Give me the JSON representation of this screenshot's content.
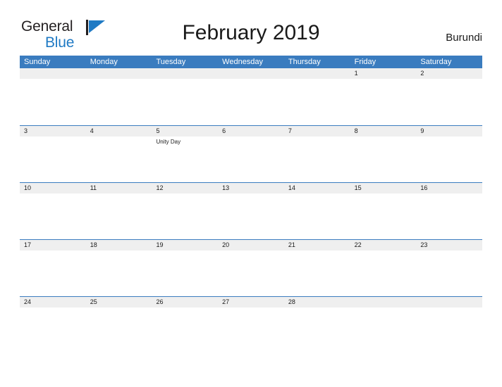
{
  "brand": {
    "name_top": "General",
    "name_bottom": "Blue",
    "flag_icon": "blue-flag-triangle",
    "color_top": "#231f20",
    "color_bottom": "#1f7ac4"
  },
  "header": {
    "title": "February 2019",
    "country": "Burundi"
  },
  "theme": {
    "header_blue": "#3a7cbf",
    "band_gray": "#efefef",
    "text_dark": "#1a1a1a",
    "page_background": "#ffffff"
  },
  "calendar": {
    "month": "February",
    "year": "2019",
    "weekday_headers": [
      "Sunday",
      "Monday",
      "Tuesday",
      "Wednesday",
      "Thursday",
      "Friday",
      "Saturday"
    ],
    "weeks": [
      [
        {
          "date": "",
          "events": []
        },
        {
          "date": "",
          "events": []
        },
        {
          "date": "",
          "events": []
        },
        {
          "date": "",
          "events": []
        },
        {
          "date": "",
          "events": []
        },
        {
          "date": "1",
          "events": []
        },
        {
          "date": "2",
          "events": []
        }
      ],
      [
        {
          "date": "3",
          "events": []
        },
        {
          "date": "4",
          "events": []
        },
        {
          "date": "5",
          "events": [
            "Unity Day"
          ]
        },
        {
          "date": "6",
          "events": []
        },
        {
          "date": "7",
          "events": []
        },
        {
          "date": "8",
          "events": []
        },
        {
          "date": "9",
          "events": []
        }
      ],
      [
        {
          "date": "10",
          "events": []
        },
        {
          "date": "11",
          "events": []
        },
        {
          "date": "12",
          "events": []
        },
        {
          "date": "13",
          "events": []
        },
        {
          "date": "14",
          "events": []
        },
        {
          "date": "15",
          "events": []
        },
        {
          "date": "16",
          "events": []
        }
      ],
      [
        {
          "date": "17",
          "events": []
        },
        {
          "date": "18",
          "events": []
        },
        {
          "date": "19",
          "events": []
        },
        {
          "date": "20",
          "events": []
        },
        {
          "date": "21",
          "events": []
        },
        {
          "date": "22",
          "events": []
        },
        {
          "date": "23",
          "events": []
        }
      ],
      [
        {
          "date": "24",
          "events": []
        },
        {
          "date": "25",
          "events": []
        },
        {
          "date": "26",
          "events": []
        },
        {
          "date": "27",
          "events": []
        },
        {
          "date": "28",
          "events": []
        },
        {
          "date": "",
          "events": []
        },
        {
          "date": "",
          "events": []
        }
      ]
    ]
  }
}
